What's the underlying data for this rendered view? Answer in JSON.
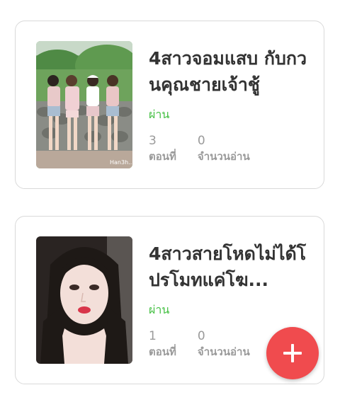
{
  "stories": [
    {
      "title": "4สาวจอมแสบ  กับกวนคุณชายเจ้าชู้",
      "status": "ผ่าน",
      "episodes": "3",
      "episodes_label": "ตอนที่",
      "reads": "0",
      "reads_label": "จำนวนอ่าน",
      "cover_watermark": "Han3h..."
    },
    {
      "title": "4สาวสายโหดไม่ได้โปรโมทแค่โฆ...",
      "status": "ผ่าน",
      "episodes": "1",
      "episodes_label": "ตอนที่",
      "reads": "0",
      "reads_label": "จำนวนอ่าน"
    }
  ],
  "fab": {
    "icon": "plus-icon"
  },
  "colors": {
    "status_green": "#44c043",
    "fab_red": "#f04b4e",
    "title": "#333333",
    "muted": "#9a9a9a"
  }
}
